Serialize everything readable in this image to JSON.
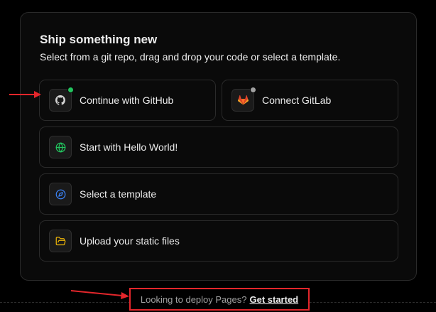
{
  "card": {
    "title": "Ship something new",
    "subtitle": "Select from a git repo, drag and drop your code or select a template."
  },
  "options": {
    "github": {
      "label": "Continue with GitHub",
      "icon": "github-icon",
      "status": "connected",
      "status_color": "#22c55e"
    },
    "gitlab": {
      "label": "Connect GitLab",
      "icon": "gitlab-icon",
      "status": "not-connected",
      "status_color": "#a1a1a1",
      "icon_color": "#fc6d26"
    },
    "hello_world": {
      "label": "Start with Hello World!",
      "icon": "globe-icon",
      "icon_color": "#22c55e"
    },
    "template": {
      "label": "Select a template",
      "icon": "compass-icon",
      "icon_color": "#3b82f6"
    },
    "upload": {
      "label": "Upload your static files",
      "icon": "folder-icon",
      "icon_color": "#eab308"
    }
  },
  "footer": {
    "text": "Looking to deploy Pages?",
    "link": "Get started"
  },
  "annotations": {
    "color": "#e3262b"
  }
}
